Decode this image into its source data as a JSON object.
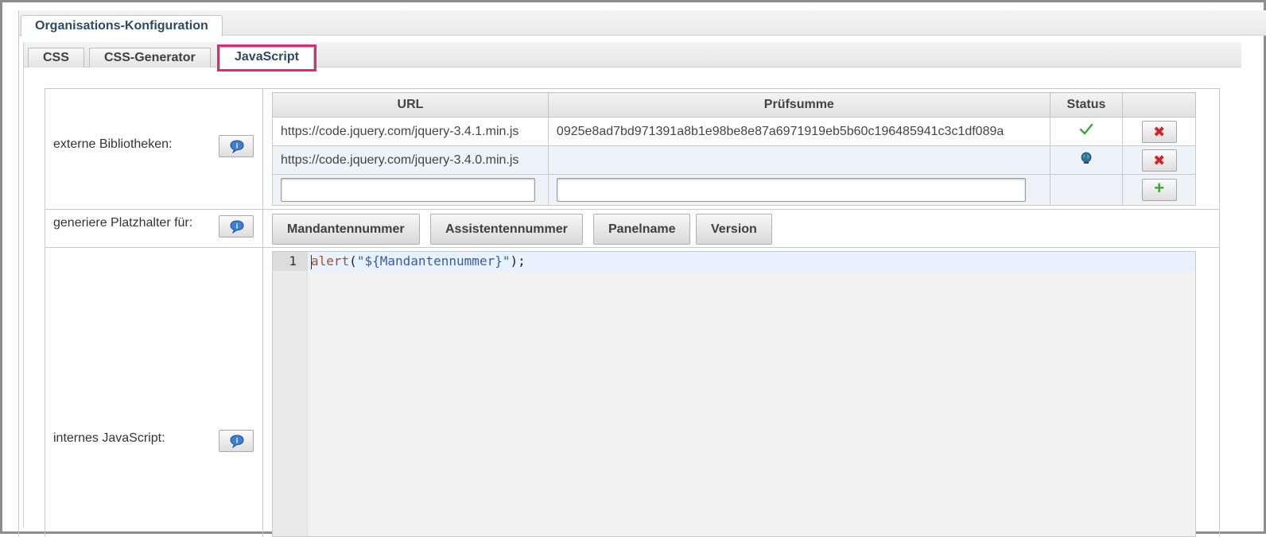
{
  "outer_tab": {
    "label": "Organisations-Konfiguration"
  },
  "inner_tabs": [
    {
      "label": "CSS"
    },
    {
      "label": "CSS-Generator"
    },
    {
      "label": "JavaScript",
      "active": true
    }
  ],
  "external_libs": {
    "label": "externe Bibliotheken:",
    "columns": {
      "url": "URL",
      "checksum": "Prüfsumme",
      "status": "Status"
    },
    "rows": [
      {
        "url": "https://code.jquery.com/jquery-3.4.1.min.js",
        "checksum": "0925e8ad7bd971391a8b1e98be8e87a6971919eb5b60c196485941c3c1df089a",
        "status_icon": "checkmark-icon",
        "delete_icon": "delete-x-icon"
      },
      {
        "url": "https://code.jquery.com/jquery-3.4.0.min.js",
        "checksum": "",
        "status_icon": "globe-icon",
        "delete_icon": "delete-x-icon"
      }
    ],
    "new_row": {
      "url_value": "",
      "checksum_value": "",
      "add_icon": "plus-icon"
    }
  },
  "placeholders": {
    "label": "generiere Platzhalter für:",
    "buttons": [
      "Mandantennummer",
      "Assistentennummer",
      "Panelname",
      "Version"
    ]
  },
  "internal_js": {
    "label": "internes JavaScript:",
    "line_number": "1",
    "code": {
      "fn": "alert",
      "open": "(",
      "str": "\"${Mandantennummer}\"",
      "close": ");"
    }
  },
  "icons": {
    "help": "info-speech-bubble-icon",
    "accent_active_tab": "#d0307a",
    "checkmark_color": "#3ba63b",
    "delete_color": "#d0242b"
  }
}
